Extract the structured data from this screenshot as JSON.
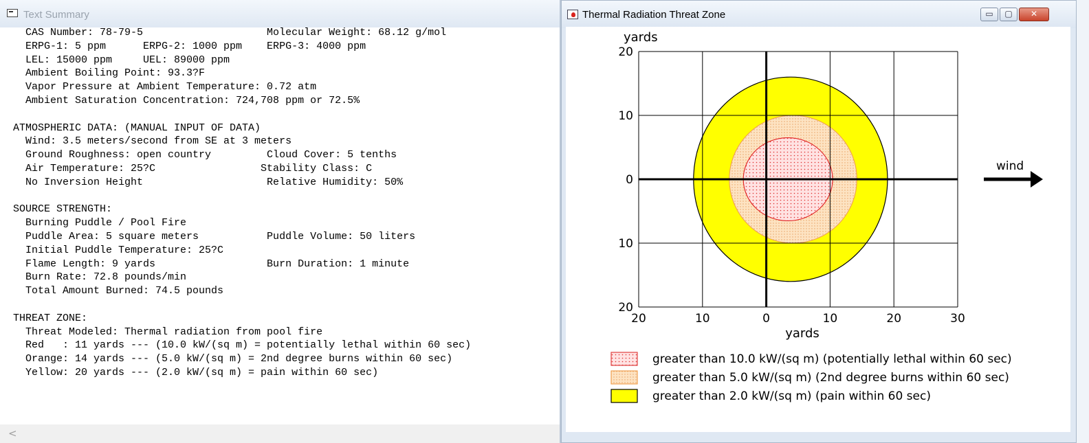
{
  "text_window": {
    "title": "Text Summary",
    "lines": [
      "  CAS Number: 78-79-5                    Molecular Weight: 68.12 g/mol",
      "  ERPG-1: 5 ppm      ERPG-2: 1000 ppm    ERPG-3: 4000 ppm",
      "  LEL: 15000 ppm     UEL: 89000 ppm",
      "  Ambient Boiling Point: 93.3?F",
      "  Vapor Pressure at Ambient Temperature: 0.72 atm",
      "  Ambient Saturation Concentration: 724,708 ppm or 72.5%",
      "",
      "ATMOSPHERIC DATA: (MANUAL INPUT OF DATA)",
      "  Wind: 3.5 meters/second from SE at 3 meters",
      "  Ground Roughness: open country         Cloud Cover: 5 tenths",
      "  Air Temperature: 25?C                 Stability Class: C",
      "  No Inversion Height                    Relative Humidity: 50%",
      "",
      "SOURCE STRENGTH:",
      "  Burning Puddle / Pool Fire",
      "  Puddle Area: 5 square meters           Puddle Volume: 50 liters",
      "  Initial Puddle Temperature: 25?C",
      "  Flame Length: 9 yards                  Burn Duration: 1 minute",
      "  Burn Rate: 72.8 pounds/min",
      "  Total Amount Burned: 74.5 pounds",
      "",
      "THREAT ZONE:",
      "  Threat Modeled: Thermal radiation from pool fire",
      "  Red   : 11 yards --- (10.0 kW/(sq m) = potentially lethal within 60 sec)",
      "  Orange: 14 yards --- (5.0 kW/(sq m) = 2nd degree burns within 60 sec)",
      "  Yellow: 20 yards --- (2.0 kW/(sq m) = pain within 60 sec)"
    ],
    "scroll_left_arrow": "<"
  },
  "plot_window": {
    "title": "Thermal Radiation Threat Zone",
    "controls": {
      "minimize": "▭",
      "maximize": "▢",
      "close": "✕"
    },
    "wind_label": "wind"
  },
  "chart_data": {
    "type": "area",
    "xlabel": "yards",
    "ylabel": "yards",
    "xlim": [
      -20,
      30
    ],
    "ylim": [
      -20,
      20
    ],
    "x_ticks": [
      "20",
      "10",
      "0",
      "10",
      "20",
      "30"
    ],
    "y_ticks": [
      "20",
      "10",
      "0",
      "10",
      "20"
    ],
    "grid": true,
    "zones": [
      {
        "name": "greater than 2.0 kW/(sq m) (pain within 60 sec)",
        "color": "#ffff00",
        "center": [
          3.8,
          0
        ],
        "rx": 15.2,
        "ry": 16
      },
      {
        "name": "greater than 5.0 kW/(sq m) (2nd degree burns within 60 sec)",
        "color": "#fcdcb4",
        "center": [
          4.2,
          0
        ],
        "rx": 10,
        "ry": 10
      },
      {
        "name": "greater than 10.0 kW/(sq m) (potentially lethal within 60 sec)",
        "color": "#ffd6d6",
        "center": [
          3.4,
          0
        ],
        "rx": 7,
        "ry": 6.5
      }
    ],
    "legend": [
      {
        "label": "greater than 10.0 kW/(sq m) (potentially lethal within 60 sec)",
        "fill": "#ffdada",
        "stroke": "#e04040",
        "pattern": "dots-red"
      },
      {
        "label": "greater than 5.0 kW/(sq m) (2nd degree burns within 60 sec)",
        "fill": "#fcdcb4",
        "stroke": "#f0a050",
        "pattern": "dots-orange"
      },
      {
        "label": "greater than 2.0 kW/(sq m) (pain within 60 sec)",
        "fill": "#ffff00",
        "stroke": "#000000",
        "pattern": "solid"
      }
    ]
  }
}
